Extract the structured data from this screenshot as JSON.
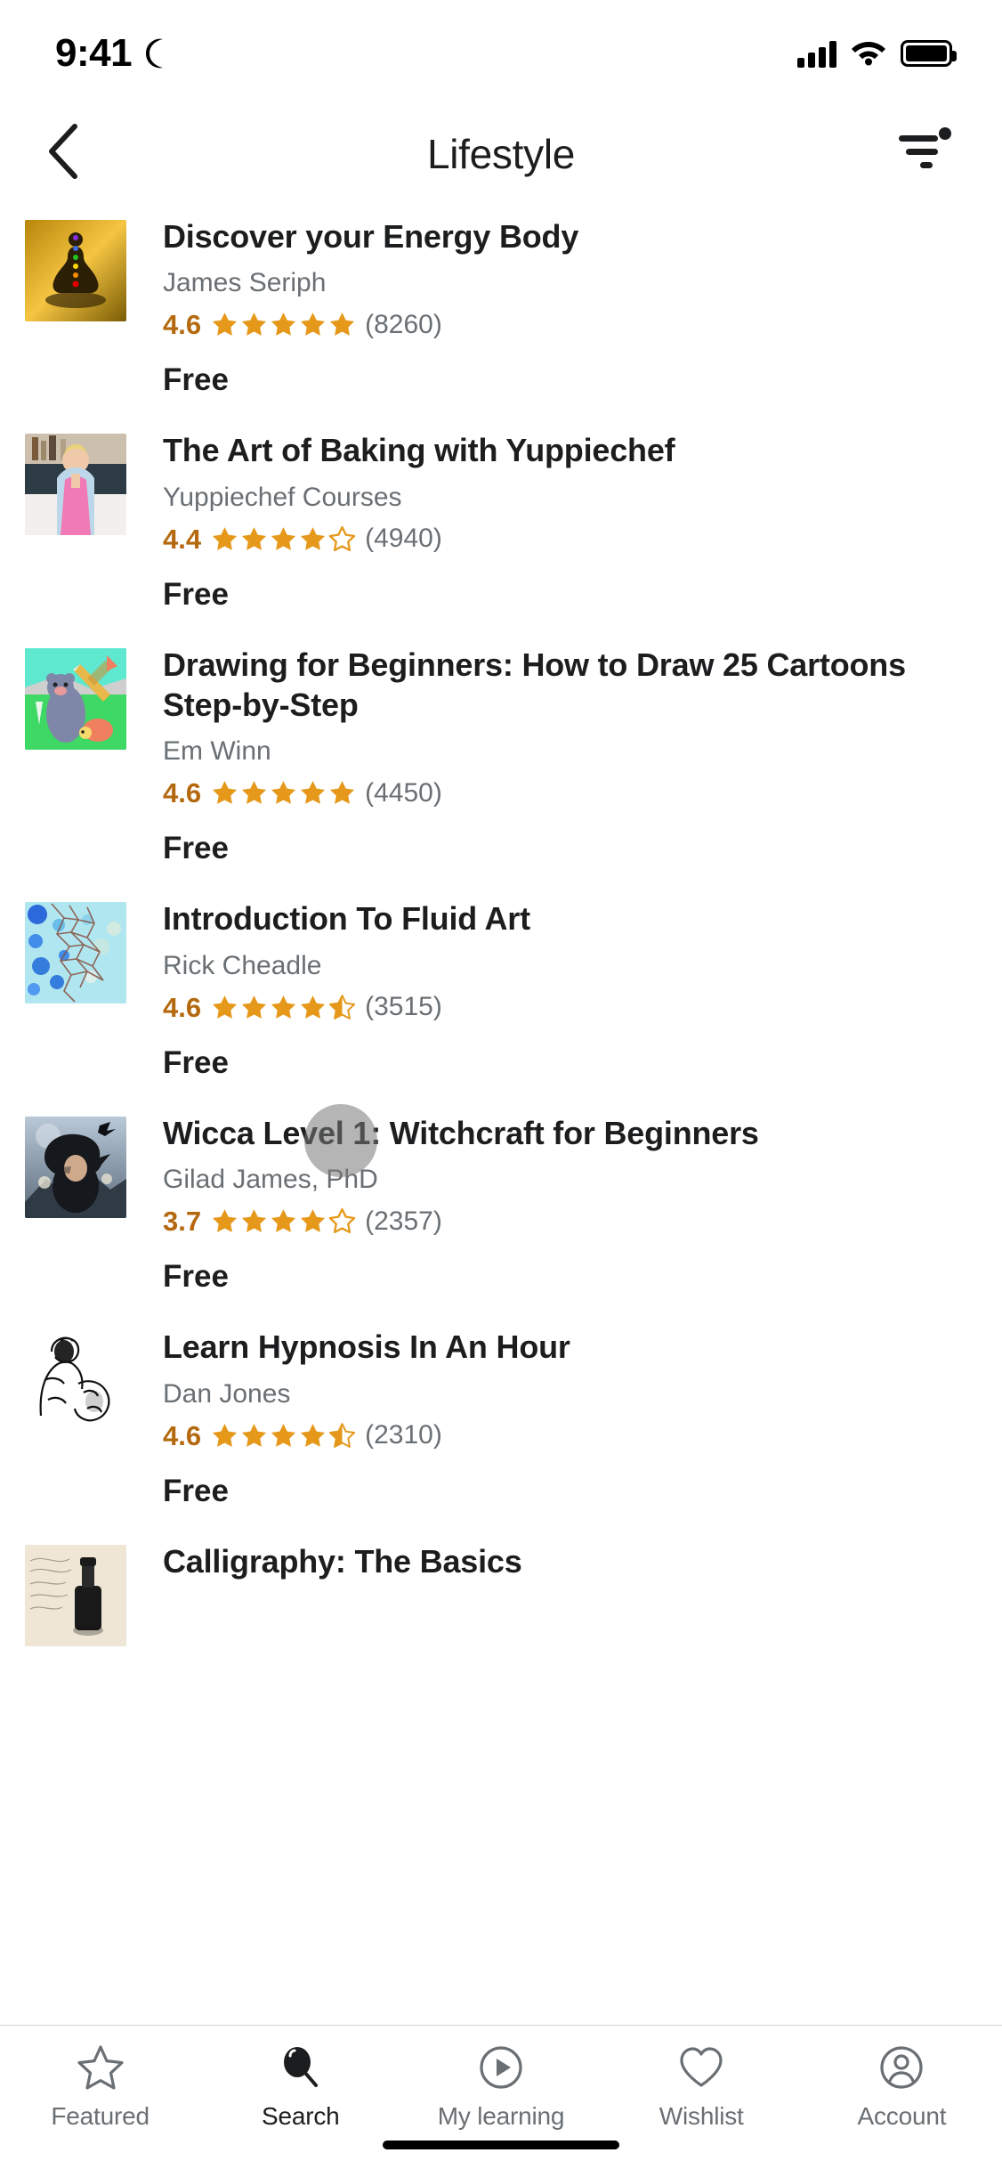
{
  "status_bar": {
    "time": "9:41",
    "dnd_icon": "crescent-moon-icon",
    "cellular_icon": "signal-bars-icon",
    "wifi_icon": "wifi-icon",
    "battery_icon": "battery-full-icon"
  },
  "header": {
    "back_icon": "chevron-left-icon",
    "title": "Lifestyle",
    "filter_icon": "filter-sort-icon",
    "filter_badge": true
  },
  "colors": {
    "rating_gold": "#b4690e",
    "star_fill": "#e59819",
    "text_primary": "#1c1d1f",
    "text_secondary": "#6a6f73",
    "divider": "#d1d7dc"
  },
  "courses": [
    {
      "title": "Discover your Energy Body",
      "author": "James Seriph",
      "rating": "4.6",
      "stars": 5,
      "half_star": false,
      "reviews": "(8260)",
      "price": "Free",
      "thumb": "chakra-meditation-thumbnail"
    },
    {
      "title": "The Art of Baking with Yuppiechef",
      "author": "Yuppiechef Courses",
      "rating": "4.4",
      "stars": 4,
      "half_star": false,
      "reviews": "(4940)",
      "price": "Free",
      "thumb": "baker-in-kitchen-thumbnail"
    },
    {
      "title": "Drawing for Beginners: How to Draw 25 Cartoons Step-by-Step",
      "author": "Em Winn",
      "rating": "4.6",
      "stars": 5,
      "half_star": false,
      "reviews": "(4450)",
      "price": "Free",
      "thumb": "cartoon-bear-drawing-thumbnail"
    },
    {
      "title": "Introduction To Fluid Art",
      "author": "Rick Cheadle",
      "rating": "4.6",
      "stars": 4,
      "half_star": true,
      "reviews": "(3515)",
      "price": "Free",
      "thumb": "fluid-art-cells-thumbnail"
    },
    {
      "title": "Wicca Level 1: Witchcraft for Beginners",
      "author": "Gilad James, PhD",
      "rating": "3.7",
      "stars": 4,
      "half_star": false,
      "reviews": "(2357)",
      "price": "Free",
      "thumb": "witch-silhouette-thumbnail"
    },
    {
      "title": "Learn Hypnosis In An Hour",
      "author": "Dan Jones",
      "rating": "4.6",
      "stars": 4,
      "half_star": true,
      "reviews": "(2310)",
      "price": "Free",
      "thumb": "hypnosis-illustration-thumbnail"
    },
    {
      "title": "Calligraphy: The Basics",
      "author": "",
      "rating": "",
      "stars": 0,
      "half_star": false,
      "reviews": "",
      "price": "",
      "thumb": "calligraphy-ink-thumbnail"
    }
  ],
  "tabs": [
    {
      "label": "Featured",
      "icon": "star-outline-icon",
      "active": false
    },
    {
      "label": "Search",
      "icon": "search-icon",
      "active": true
    },
    {
      "label": "My learning",
      "icon": "play-circle-icon",
      "active": false
    },
    {
      "label": "Wishlist",
      "icon": "heart-outline-icon",
      "active": false
    },
    {
      "label": "Account",
      "icon": "person-circle-icon",
      "active": false
    }
  ]
}
